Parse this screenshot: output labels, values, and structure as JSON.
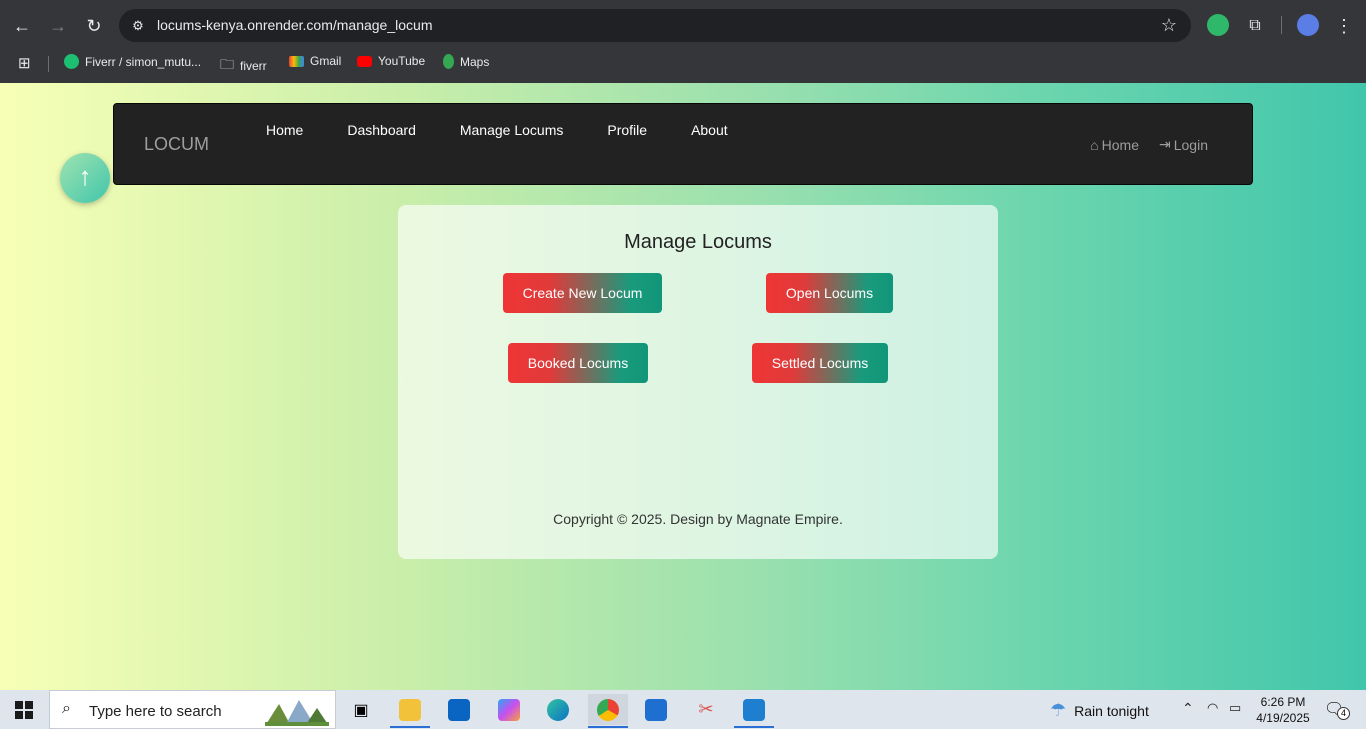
{
  "browser": {
    "url": "locums-kenya.onrender.com/manage_locum",
    "bookmarks": [
      {
        "label": "Fiverr / simon_mutu...",
        "icon": "fiverr-icon"
      },
      {
        "label": "fiverr",
        "icon": "folder-icon"
      },
      {
        "label": "Gmail",
        "icon": "gmail-icon"
      },
      {
        "label": "YouTube",
        "icon": "youtube-icon"
      },
      {
        "label": "Maps",
        "icon": "maps-icon"
      }
    ]
  },
  "navbar": {
    "brand": "LOCUM",
    "links": [
      "Home",
      "Dashboard",
      "Manage Locums",
      "Profile",
      "About"
    ],
    "right_home": "Home",
    "right_login": "Login"
  },
  "scroll_top": "↑",
  "card": {
    "title": "Manage Locums",
    "buttons": [
      "Create New Locum",
      "Open Locums",
      "Booked Locums",
      "Settled Locums"
    ],
    "copyright": "Copyright © 2025. Design by Magnate Empire."
  },
  "taskbar": {
    "search_placeholder": "Type here to search",
    "weather": "Rain tonight",
    "time": "6:26 PM",
    "date": "4/19/2025",
    "notifications": "4"
  },
  "colors": {
    "button_start": "#ef3535",
    "button_end": "#119679",
    "navbar_bg": "#222222"
  }
}
